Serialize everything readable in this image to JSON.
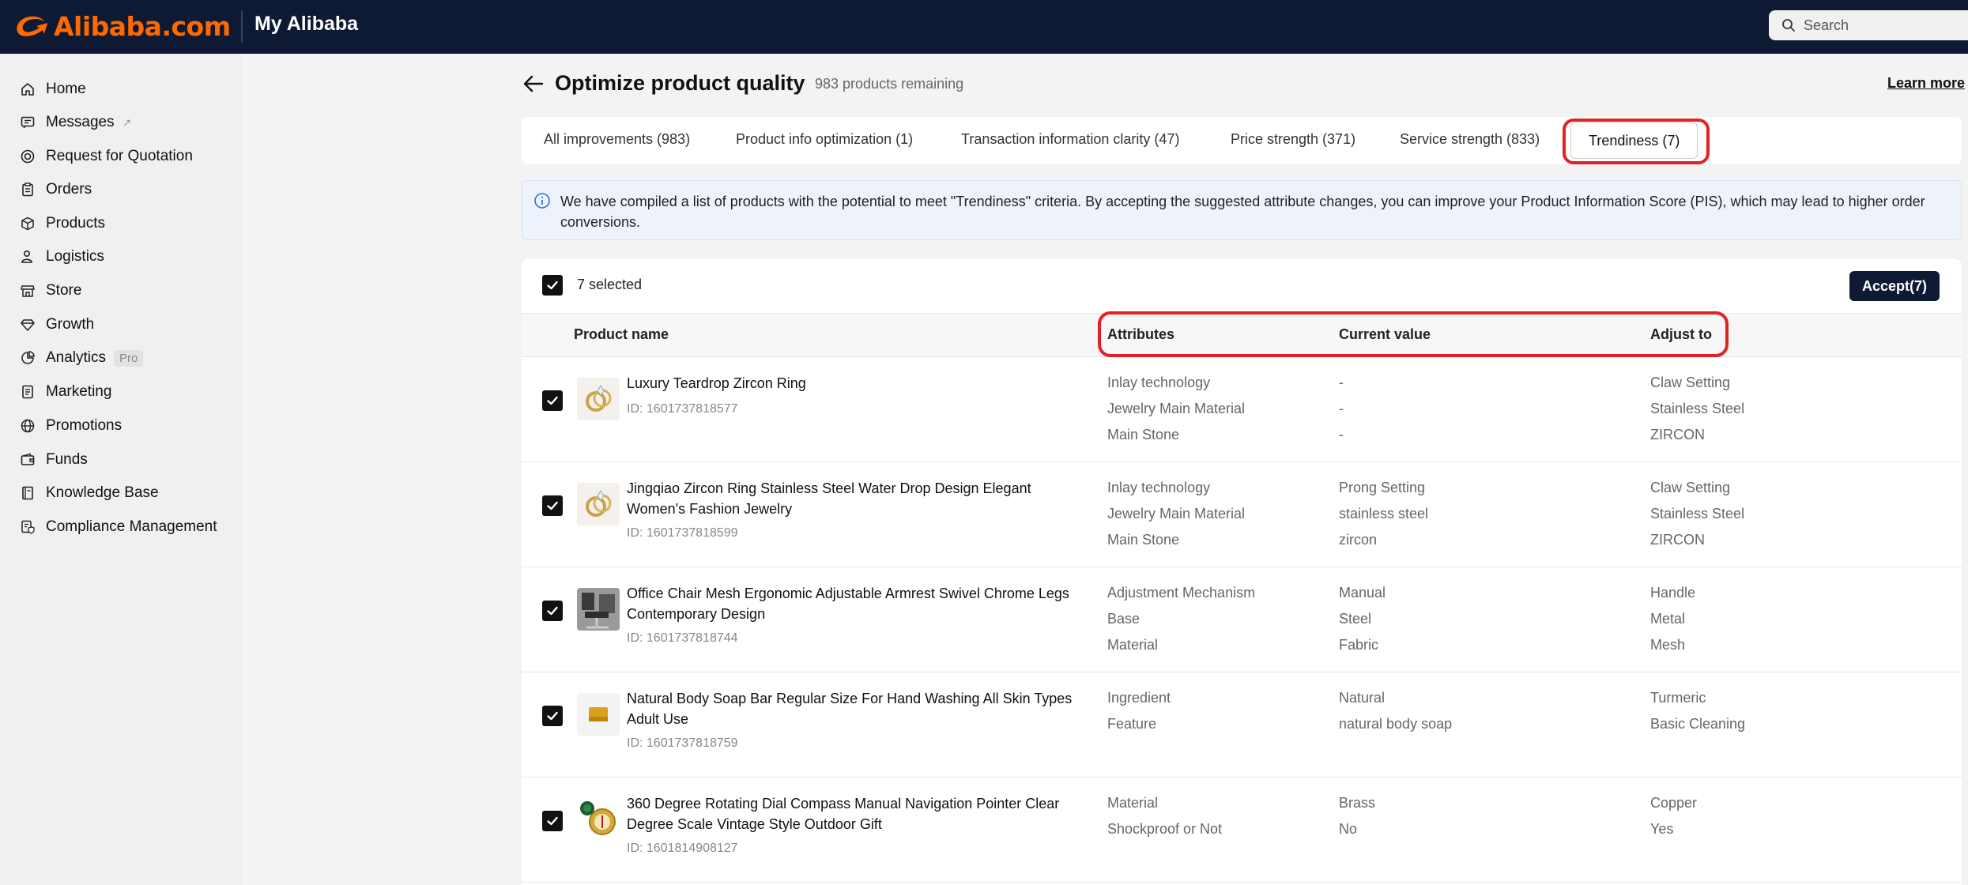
{
  "header": {
    "logo_text": "Alibaba.com",
    "title": "My Alibaba",
    "search_placeholder": "Search",
    "brand_color": "#ff6a00",
    "bar_color": "#0e1a33"
  },
  "sidebar": {
    "items": [
      {
        "label": "Home",
        "icon": "home-icon"
      },
      {
        "label": "Messages",
        "icon": "message-icon",
        "suffix": "↗"
      },
      {
        "label": "Request for Quotation",
        "icon": "target-icon"
      },
      {
        "label": "Orders",
        "icon": "clipboard-icon"
      },
      {
        "label": "Products",
        "icon": "box-icon"
      },
      {
        "label": "Logistics",
        "icon": "user-truck-icon"
      },
      {
        "label": "Store",
        "icon": "store-icon"
      },
      {
        "label": "Growth",
        "icon": "diamond-icon"
      },
      {
        "label": "Analytics",
        "icon": "chart-icon",
        "badge": "Pro"
      },
      {
        "label": "Marketing",
        "icon": "document-icon"
      },
      {
        "label": "Promotions",
        "icon": "globe-icon"
      },
      {
        "label": "Funds",
        "icon": "wallet-icon"
      },
      {
        "label": "Knowledge Base",
        "icon": "book-icon"
      },
      {
        "label": "Compliance Management",
        "icon": "shield-doc-icon"
      }
    ]
  },
  "page": {
    "title": "Optimize product quality",
    "remaining": "983 products remaining",
    "learn_more": "Learn more"
  },
  "tabs": [
    {
      "label": "All improvements (983)"
    },
    {
      "label": "Product info optimization (1)"
    },
    {
      "label": "Transaction information clarity (47)"
    },
    {
      "label": "Price strength (371)"
    },
    {
      "label": "Service strength (833)"
    },
    {
      "label": "Trendiness (7)",
      "active": true
    }
  ],
  "info": {
    "text": "We have compiled a list of products with the potential to meet \"Trendiness\" criteria. By accepting the suggested attribute changes, you can improve your Product Information Score (PIS), which may lead to higher order conversions."
  },
  "table": {
    "selected_label": "7 selected",
    "accept_label": "Accept(7)",
    "headers": {
      "product": "Product name",
      "attributes": "Attributes",
      "current": "Current value",
      "adjust": "Adjust to"
    },
    "rows": [
      {
        "name": "Luxury Teardrop Zircon Ring",
        "id": "ID: 1601737818577",
        "thumb": "ring-thumbnail",
        "attributes": [
          "Inlay technology",
          "Jewelry Main Material",
          "Main Stone"
        ],
        "current": [
          "-",
          "-",
          "-"
        ],
        "adjust": [
          "Claw Setting",
          "Stainless Steel",
          "ZIRCON"
        ]
      },
      {
        "name": "Jingqiao Zircon Ring Stainless Steel Water Drop Design Elegant Women's Fashion Jewelry",
        "id": "ID: 1601737818599",
        "thumb": "ring-thumbnail",
        "attributes": [
          "Inlay technology",
          "Jewelry Main Material",
          "Main Stone"
        ],
        "current": [
          "Prong Setting",
          "stainless steel",
          "zircon"
        ],
        "adjust": [
          "Claw Setting",
          "Stainless Steel",
          "ZIRCON"
        ]
      },
      {
        "name": "Office Chair Mesh Ergonomic Adjustable Armrest Swivel Chrome Legs Contemporary Design",
        "id": "ID: 1601737818744",
        "thumb": "chair-thumbnail",
        "attributes": [
          "Adjustment Mechanism",
          "Base",
          "Material"
        ],
        "current": [
          "Manual",
          "Steel",
          "Fabric"
        ],
        "adjust": [
          "Handle",
          "Metal",
          "Mesh"
        ]
      },
      {
        "name": "Natural Body Soap Bar Regular Size For Hand Washing All Skin Types Adult Use",
        "id": "ID: 1601737818759",
        "thumb": "soap-thumbnail",
        "attributes": [
          "Ingredient",
          "Feature"
        ],
        "current": [
          "Natural",
          "natural body soap"
        ],
        "adjust": [
          "Turmeric",
          "Basic Cleaning"
        ]
      },
      {
        "name": "360 Degree Rotating Dial Compass Manual Navigation Pointer Clear Degree Scale Vintage Style Outdoor Gift",
        "id": "ID: 1601814908127",
        "thumb": "compass-thumbnail",
        "attributes": [
          "Material",
          "Shockproof or Not"
        ],
        "current": [
          "Brass",
          "No"
        ],
        "adjust": [
          "Copper",
          "Yes"
        ]
      }
    ]
  },
  "highlight_color": "#e32124"
}
